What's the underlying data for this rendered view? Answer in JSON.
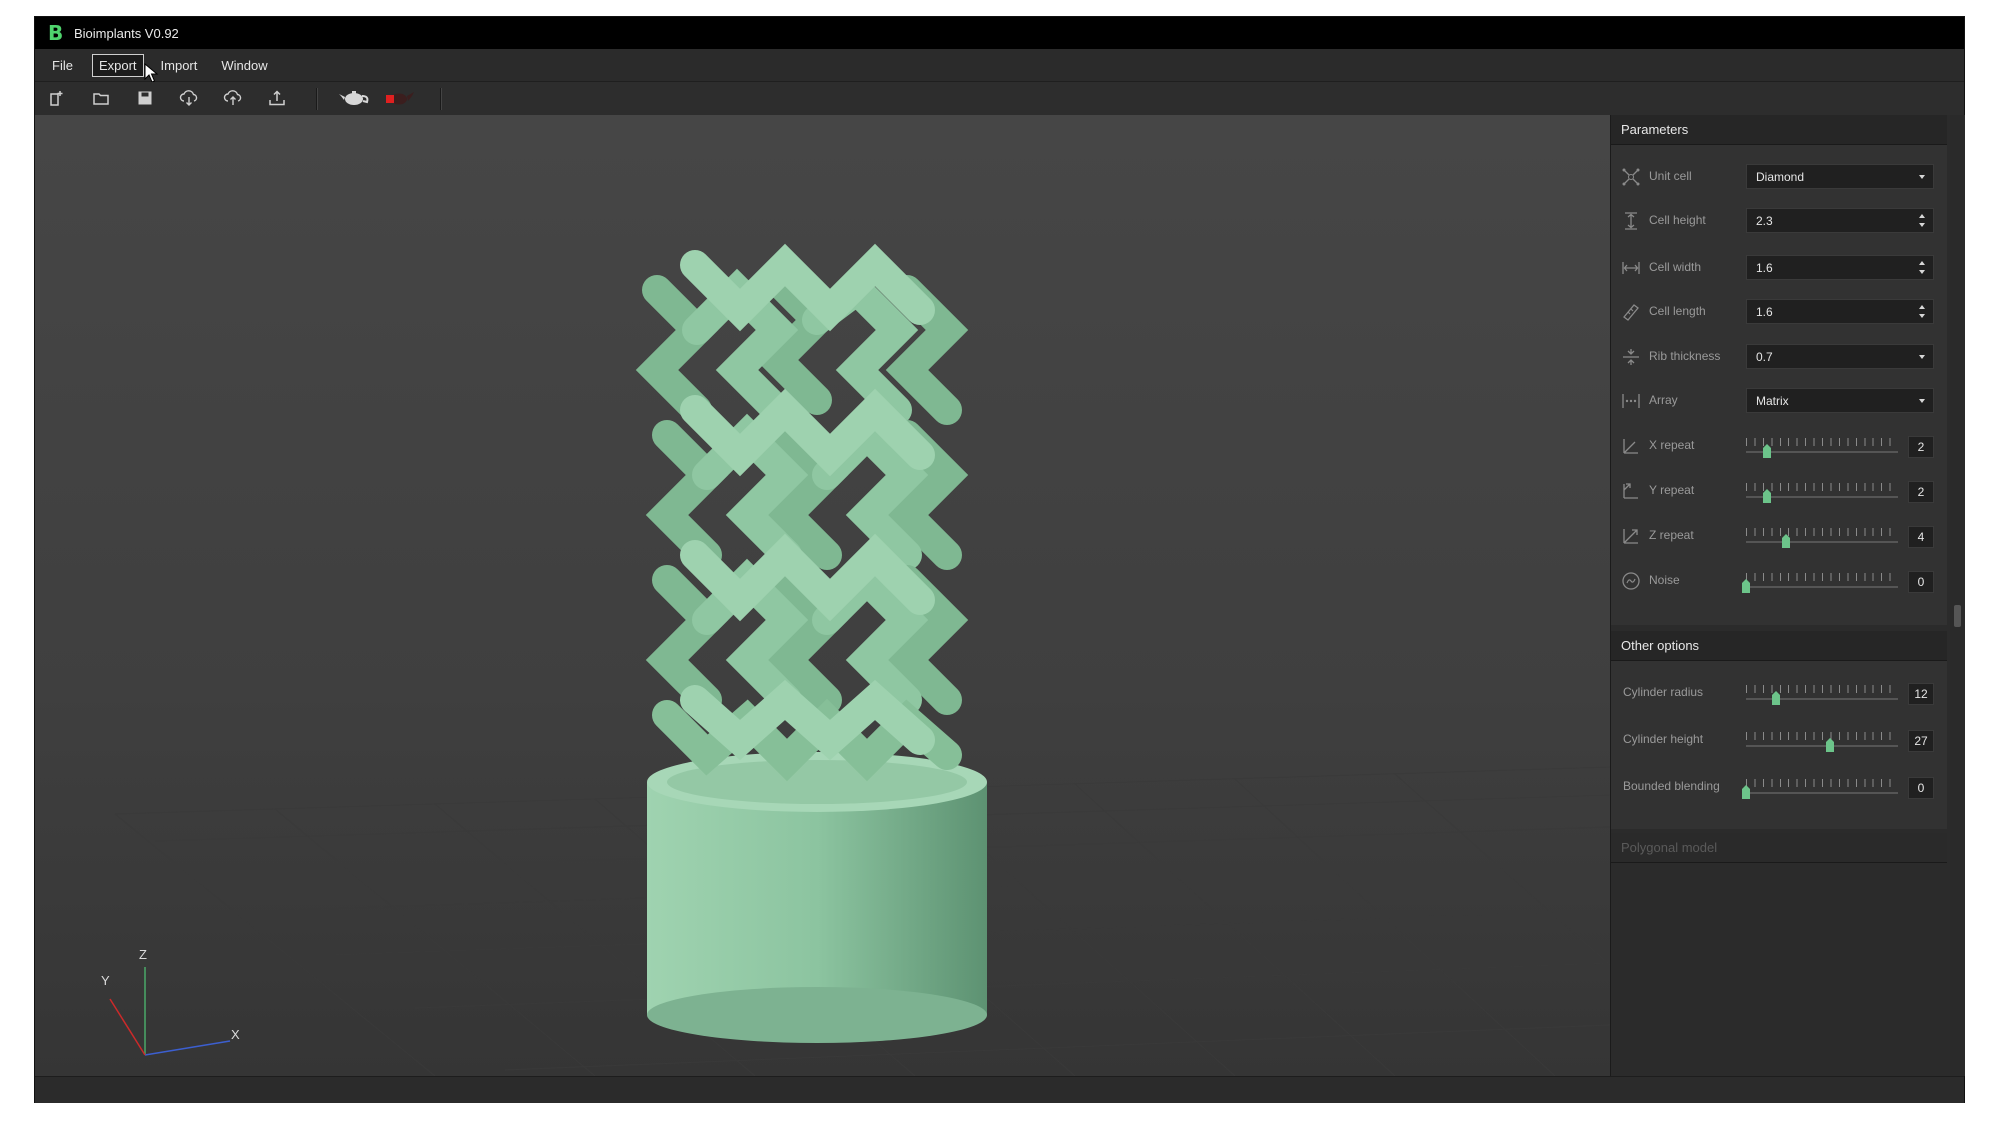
{
  "window": {
    "title": "Bioimplants V0.92",
    "logo": "B"
  },
  "menu": [
    {
      "label": "File"
    },
    {
      "label": "Export"
    },
    {
      "label": "Import"
    },
    {
      "label": "Window"
    }
  ],
  "toolbar": {
    "icons": [
      "new-file-icon",
      "open-folder-icon",
      "save-icon",
      "cloud-download-icon",
      "cloud-upload-icon",
      "export-tray-icon",
      "teapot-icon",
      "red-teapot-icon"
    ]
  },
  "viewport": {
    "axes": {
      "x": "X",
      "y": "Y",
      "z": "Z"
    },
    "model_color": "#93c9a6"
  },
  "parameters": {
    "title": "Parameters",
    "unit_cell": {
      "label": "Unit cell",
      "value": "Diamond"
    },
    "cell_height": {
      "label": "Cell height",
      "value": "2.3"
    },
    "cell_width": {
      "label": "Cell width",
      "value": "1.6"
    },
    "cell_length": {
      "label": "Cell length",
      "value": "1.6"
    },
    "rib_thickness": {
      "label": "Rib thickness",
      "value": "0.7"
    },
    "array": {
      "label": "Array",
      "value": "Matrix"
    },
    "x_repeat": {
      "label": "X repeat",
      "value": "2",
      "fraction": 0.14
    },
    "y_repeat": {
      "label": "Y repeat",
      "value": "2",
      "fraction": 0.14
    },
    "z_repeat": {
      "label": "Z repeat",
      "value": "4",
      "fraction": 0.26
    },
    "noise": {
      "label": "Noise",
      "value": "0",
      "fraction": 0.0
    }
  },
  "other_options": {
    "title": "Other options",
    "cylinder_radius": {
      "label": "Cylinder radius",
      "value": "12",
      "fraction": 0.2
    },
    "cylinder_height": {
      "label": "Cylinder height",
      "value": "27",
      "fraction": 0.55
    },
    "bounded_blending": {
      "label": "Bounded blending",
      "value": "0",
      "fraction": 0.0
    }
  },
  "polygonal_model": {
    "title": "Polygonal model"
  },
  "colors": {
    "accent": "#4fd46d",
    "slider_handle": "#6cc48a"
  }
}
